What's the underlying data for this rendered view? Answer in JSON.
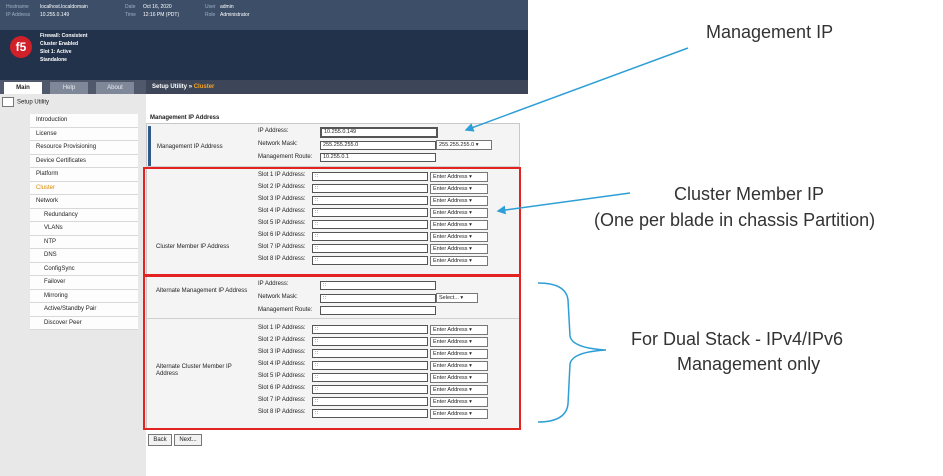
{
  "header": {
    "hostname_label": "Hostname",
    "hostname": "localhost.localdomain",
    "ip_label": "IP Address",
    "ip": "10.255.0.149",
    "date_label": "Date",
    "date": "Oct 16, 2020",
    "time_label": "Time",
    "time": "12:16 PM (PDT)",
    "user_label": "User",
    "user": "admin",
    "role_label": "Role",
    "role": "Administrator"
  },
  "logo": "f5",
  "status": [
    "Firewall: Consistent",
    "Cluster Enabled",
    "Slot 1: Active",
    "Standalone"
  ],
  "tabs": [
    "Main",
    "Help",
    "About"
  ],
  "breadcrumb": {
    "parent": "Setup Utility",
    "sep": "»",
    "current": "Cluster"
  },
  "sidebar": {
    "header": "Setup Utility",
    "items": [
      "Introduction",
      "License",
      "Resource Provisioning",
      "Device Certificates",
      "Platform",
      "Cluster",
      "Network",
      "Redundancy",
      "VLANs",
      "NTP",
      "DNS",
      "ConfigSync",
      "Failover",
      "Mirroring",
      "Active/Standby Pair",
      "Discover Peer"
    ]
  },
  "form": {
    "section_title": "Management IP Address",
    "mgmt": {
      "label": "Management IP Address",
      "ip_label": "IP Address:",
      "ip_value": "10.255.0.149",
      "mask_label": "Network Mask:",
      "mask_value": "255.255.255.0",
      "mask_select": "255.255.255.0",
      "route_label": "Management Route:",
      "route_value": "10.255.0.1"
    },
    "cluster": {
      "label": "Cluster Member IP Address",
      "slot_labels": [
        "Slot 1 IP Address:",
        "Slot 2 IP Address:",
        "Slot 3 IP Address:",
        "Slot 4 IP Address:",
        "Slot 5 IP Address:",
        "Slot 6 IP Address:",
        "Slot 7 IP Address:",
        "Slot 8 IP Address:"
      ],
      "slot_value": "::",
      "select": "Enter Address"
    },
    "alt_mgmt": {
      "label": "Alternate Management IP Address",
      "ip_label": "IP Address:",
      "ip_value": "::",
      "mask_label": "Network Mask:",
      "mask_value": "::",
      "mask_select": "Select...",
      "route_label": "Management Route:",
      "route_value": ""
    },
    "alt_cluster": {
      "label": "Alternate Cluster Member IP Address",
      "slot_labels": [
        "Slot 1 IP Address:",
        "Slot 2 IP Address:",
        "Slot 3 IP Address:",
        "Slot 4 IP Address:",
        "Slot 5 IP Address:",
        "Slot 6 IP Address:",
        "Slot 7 IP Address:",
        "Slot 8 IP Address:"
      ],
      "slot_value": "::",
      "select": "Enter Address"
    },
    "buttons": {
      "back": "Back",
      "next": "Next..."
    }
  },
  "annotations": {
    "mgmt_ip": "Management IP",
    "cluster_line1": "Cluster Member IP",
    "cluster_line2": "(One per blade in chassis Partition)",
    "dual_line1": "For Dual Stack - IPv4/IPv6",
    "dual_line2": "Management only"
  },
  "colors": {
    "highlight_box": "#e32222",
    "arrow": "#2e9fd6",
    "accent": "#f7a520"
  }
}
